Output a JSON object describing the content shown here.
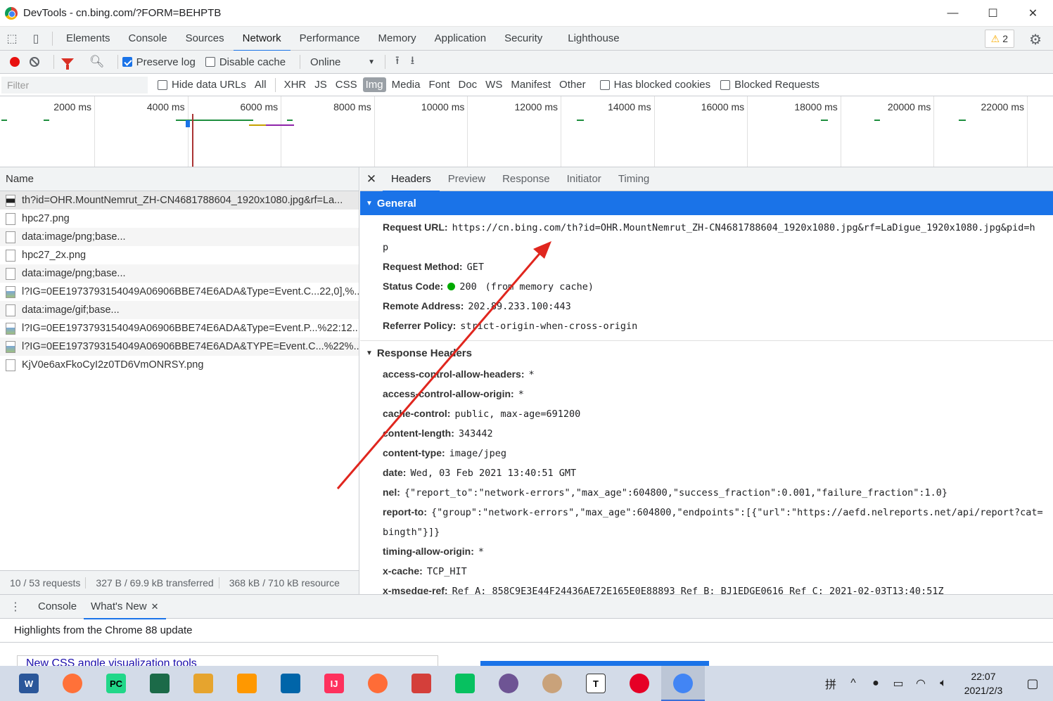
{
  "window": {
    "title": "DevTools - cn.bing.com/?FORM=BEHPTB",
    "minimize": "—",
    "maximize": "☐",
    "close": "✕"
  },
  "tabs": [
    "Elements",
    "Console",
    "Sources",
    "Network",
    "Performance",
    "Memory",
    "Application",
    "Security",
    "Lighthouse"
  ],
  "active_tab": "Network",
  "warnings_count": "2",
  "network_toolbar": {
    "preserve_log": "Preserve log",
    "preserve_log_checked": true,
    "disable_cache": "Disable cache",
    "disable_cache_checked": false,
    "throttling": "Online"
  },
  "filter_bar": {
    "placeholder": "Filter",
    "hide_data_urls": "Hide data URLs",
    "types": [
      "All",
      "XHR",
      "JS",
      "CSS",
      "Img",
      "Media",
      "Font",
      "Doc",
      "WS",
      "Manifest",
      "Other"
    ],
    "active_type": "Img",
    "has_blocked_cookies": "Has blocked cookies",
    "blocked_requests": "Blocked Requests"
  },
  "overview": {
    "ticks": [
      "2000 ms",
      "4000 ms",
      "6000 ms",
      "8000 ms",
      "10000 ms",
      "12000 ms",
      "14000 ms",
      "16000 ms",
      "18000 ms",
      "20000 ms",
      "22000 ms"
    ]
  },
  "requests": {
    "column_name": "Name",
    "items": [
      {
        "name": "th?id=OHR.MountNemrut_ZH-CN4681788604_1920x1080.jpg&rf=La...",
        "icon": "image-file-icon"
      },
      {
        "name": "hpc27.png",
        "icon": "file-icon"
      },
      {
        "name": "data:image/png;base...",
        "icon": "file-icon"
      },
      {
        "name": "hpc27_2x.png",
        "icon": "file-icon"
      },
      {
        "name": "data:image/png;base...",
        "icon": "file-icon"
      },
      {
        "name": "l?IG=0EE1973793154049A06906BBE74E6ADA&Type=Event.C...22,0],%...",
        "icon": "image-file-icon"
      },
      {
        "name": "data:image/gif;base...",
        "icon": "file-icon"
      },
      {
        "name": "l?IG=0EE1973793154049A06906BBE74E6ADA&Type=Event.P...%22:12...",
        "icon": "image-file-icon"
      },
      {
        "name": "l?IG=0EE1973793154049A06906BBE74E6ADA&TYPE=Event.C...%22%...",
        "icon": "image-file-icon"
      },
      {
        "name": "KjV0e6axFkoCyI2z0TD6VmONRSY.png",
        "icon": "file-icon"
      }
    ]
  },
  "status": {
    "requests": "10 / 53 requests",
    "transferred": "327 B / 69.9 kB transferred",
    "resources": "368 kB / 710 kB resource"
  },
  "detail_tabs": [
    "Headers",
    "Preview",
    "Response",
    "Initiator",
    "Timing"
  ],
  "active_detail_tab": "Headers",
  "general": {
    "title": "General",
    "request_url_key": "Request URL:",
    "request_url": "https://cn.bing.com/th?id=OHR.MountNemrut_ZH-CN4681788604_1920x1080.jpg&rf=LaDigue_1920x1080.jpg&pid=h",
    "request_url_wrap": "p",
    "method_key": "Request Method:",
    "method": "GET",
    "status_key": "Status Code:",
    "status_code": "200",
    "status_note": "(from memory cache)",
    "remote_key": "Remote Address:",
    "remote": "202.89.233.100:443",
    "referrer_key": "Referrer Policy:",
    "referrer": "strict-origin-when-cross-origin"
  },
  "response_headers": {
    "title": "Response Headers",
    "rows": [
      {
        "k": "access-control-allow-headers:",
        "v": "*"
      },
      {
        "k": "access-control-allow-origin:",
        "v": "*"
      },
      {
        "k": "cache-control:",
        "v": "public, max-age=691200"
      },
      {
        "k": "content-length:",
        "v": "343442"
      },
      {
        "k": "content-type:",
        "v": "image/jpeg"
      },
      {
        "k": "date:",
        "v": "Wed, 03 Feb 2021 13:40:51 GMT"
      },
      {
        "k": "nel:",
        "v": "{\"report_to\":\"network-errors\",\"max_age\":604800,\"success_fraction\":0.001,\"failure_fraction\":1.0}"
      },
      {
        "k": "report-to:",
        "v": "{\"group\":\"network-errors\",\"max_age\":604800,\"endpoints\":[{\"url\":\"https://aefd.nelreports.net/api/report?cat="
      },
      {
        "k": "",
        "v": "bingth\"}]}"
      },
      {
        "k": "timing-allow-origin:",
        "v": "*"
      },
      {
        "k": "x-cache:",
        "v": "TCP_HIT"
      },
      {
        "k": "x-msedge-ref:",
        "v": "Ref A: 858C9E3E44F24436AE72E165E0E88893 Ref B: BJ1EDGE0616 Ref C: 2021-02-03T13:40:51Z"
      }
    ]
  },
  "drawer": {
    "tabs": [
      "Console",
      "What's New"
    ],
    "active": "What's New",
    "message": "Highlights from the Chrome 88 update",
    "card_title": "New CSS angle visualization tools"
  },
  "taskbar": {
    "apps": [
      "word",
      "firefox",
      "pycharm",
      "vpn",
      "git-gui",
      "sublime",
      "vscode",
      "intellij",
      "postman",
      "netease",
      "wechat",
      "github",
      "avatar",
      "typora",
      "netease-music",
      "chrome"
    ],
    "ime": "拼",
    "time": "22:07",
    "date": "2021/2/3"
  },
  "colors": {
    "accent": "#1a73e8",
    "record": "#e8110f",
    "arrow": "#e0261e"
  }
}
